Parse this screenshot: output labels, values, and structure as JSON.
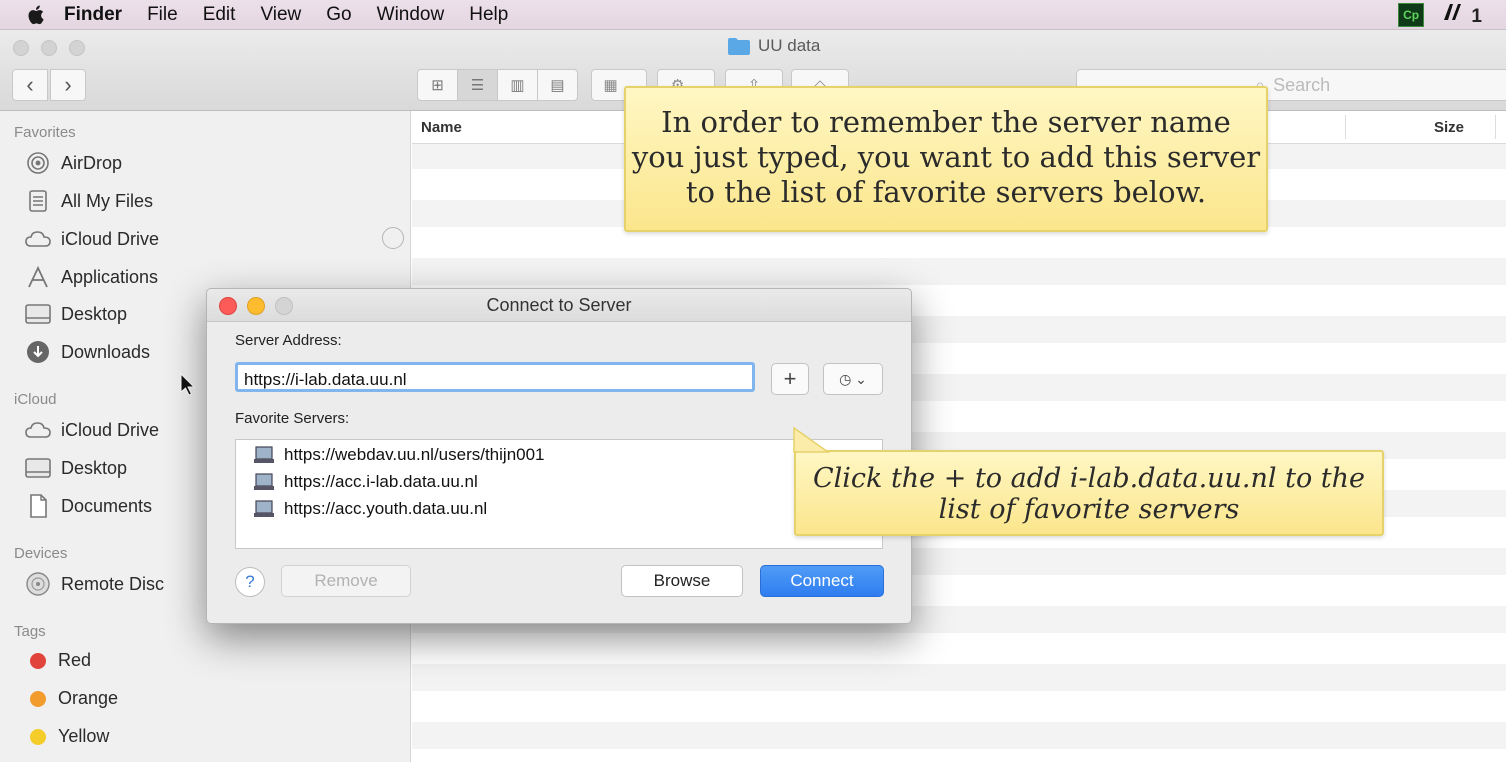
{
  "menubar": {
    "items": [
      "Finder",
      "File",
      "Edit",
      "View",
      "Go",
      "Window",
      "Help"
    ],
    "right_badge": "Cp",
    "right_text": "1"
  },
  "window": {
    "title": "UU data",
    "search_placeholder": "Search",
    "column_name": "Name",
    "column_size": "Size"
  },
  "sidebar": {
    "sections": {
      "favorites": "Favorites",
      "icloud": "iCloud",
      "devices": "Devices",
      "tags": "Tags"
    },
    "favorites": [
      "AirDrop",
      "All My Files",
      "iCloud Drive",
      "Applications",
      "Desktop",
      "Downloads"
    ],
    "icloud": [
      "iCloud Drive",
      "Desktop",
      "Documents"
    ],
    "devices": [
      "Remote Disc"
    ],
    "tags": [
      {
        "label": "Red",
        "color": "#e0443a"
      },
      {
        "label": "Orange",
        "color": "#f29c2e"
      },
      {
        "label": "Yellow",
        "color": "#f4cd2a"
      }
    ]
  },
  "dialog": {
    "title": "Connect to Server",
    "server_address_label": "Server Address:",
    "server_address_value": "https://i-lab.data.uu.nl",
    "favorite_servers_label": "Favorite Servers:",
    "favorites": [
      "https://webdav.uu.nl/users/thijn001",
      "https://acc.i-lab.data.uu.nl",
      "https://acc.youth.data.uu.nl"
    ],
    "help_label": "?",
    "remove_label": "Remove",
    "browse_label": "Browse",
    "connect_label": "Connect",
    "plus_label": "+"
  },
  "callouts": {
    "top": "In order to remember the server name you just typed, you want to add this server to the list of favorite servers below.",
    "bottom": "Click the + to add i-lab.data.uu.nl to the list of favorite servers"
  },
  "colors": {
    "accent": "#3b8cf5",
    "callout_bg": "#fbe68c"
  }
}
